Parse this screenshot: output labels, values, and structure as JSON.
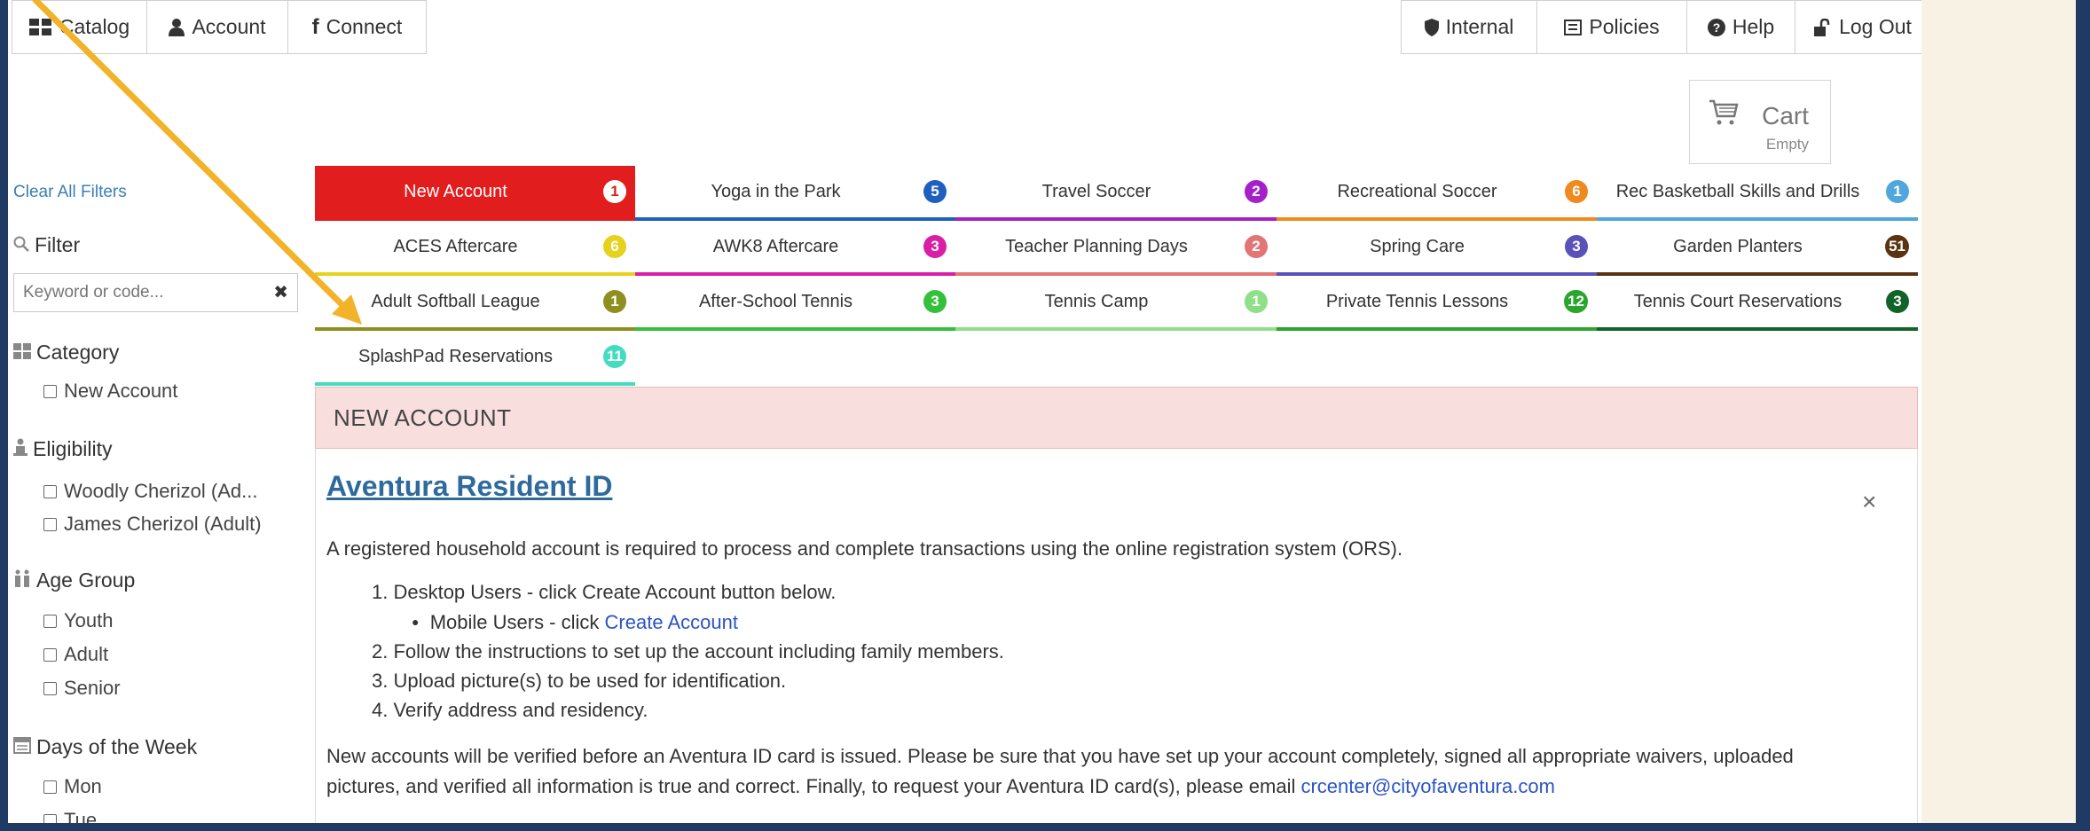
{
  "toolbar": {
    "left": [
      {
        "label": "Catalog",
        "icon": "grid-icon"
      },
      {
        "label": "Account",
        "icon": "user-icon"
      },
      {
        "label": "Connect",
        "icon": "facebook-icon"
      }
    ],
    "right": [
      {
        "label": "Internal",
        "icon": "shield-icon"
      },
      {
        "label": "Policies",
        "icon": "document-icon"
      },
      {
        "label": "Help",
        "icon": "help-icon"
      },
      {
        "label": "Log Out",
        "icon": "unlock-icon"
      }
    ]
  },
  "cart": {
    "label": "Cart",
    "status": "Empty"
  },
  "sidebar": {
    "clear_filters": "Clear All Filters",
    "filter_heading": "Filter",
    "search_placeholder": "Keyword or code...",
    "search_clear": "✖",
    "category": {
      "heading": "Category",
      "items": [
        "New Account"
      ]
    },
    "eligibility": {
      "heading": "Eligibility",
      "items": [
        "Woodly Cherizol (Ad...",
        "James Cherizol (Adult)"
      ]
    },
    "age_group": {
      "heading": "Age Group",
      "items": [
        "Youth",
        "Adult",
        "Senior"
      ]
    },
    "days_of_week": {
      "heading": "Days of the Week",
      "items": [
        "Mon",
        "Tue"
      ]
    }
  },
  "categories": [
    {
      "label": "New Account",
      "count": "1",
      "color": "#e21d1d",
      "active": true
    },
    {
      "label": "Yoga in the Park",
      "count": "5",
      "color": "#1f5fc0"
    },
    {
      "label": "Travel Soccer",
      "count": "2",
      "color": "#a620c9"
    },
    {
      "label": "Recreational Soccer",
      "count": "6",
      "color": "#f08a1c"
    },
    {
      "label": "Rec Basketball Skills and Drills",
      "count": "1",
      "color": "#4fa7de"
    },
    {
      "label": "ACES Aftercare",
      "count": "6",
      "color": "#e6d21d"
    },
    {
      "label": "AWK8 Aftercare",
      "count": "3",
      "color": "#d91fa7"
    },
    {
      "label": "Teacher Planning Days",
      "count": "2",
      "color": "#e27575"
    },
    {
      "label": "Spring Care",
      "count": "3",
      "color": "#5a52b8"
    },
    {
      "label": "Garden Planters",
      "count": "51",
      "color": "#5b3310"
    },
    {
      "label": "Adult Softball League",
      "count": "1",
      "color": "#8f8f1f"
    },
    {
      "label": "After-School Tennis",
      "count": "3",
      "color": "#35c03b"
    },
    {
      "label": "Tennis Camp",
      "count": "1",
      "color": "#8fe088"
    },
    {
      "label": "Private Tennis Lessons",
      "count": "12",
      "color": "#2aa52e"
    },
    {
      "label": "Tennis Court Reservations",
      "count": "3",
      "color": "#12632a"
    },
    {
      "label": "SplashPad Reservations",
      "count": "11",
      "color": "#44dcc0"
    }
  ],
  "section": {
    "heading": "NEW ACCOUNT",
    "item_title": "Aventura Resident ID",
    "close": "×",
    "intro": "A registered household account is required to process and complete transactions using the online registration system (ORS).",
    "steps": [
      "1. Desktop Users - click Create Account button below.",
      "2. Follow the instructions to set up the account including family members.",
      "3. Upload picture(s) to be used for identification.",
      "4. Verify address and residency."
    ],
    "mobile_prefix": "Mobile Users - click ",
    "mobile_link": "Create Account",
    "footer_line1": "New accounts will be verified before an Aventura ID card is issued. Please be sure that you have set up your account completely, signed all appropriate waivers, uploaded",
    "footer_line2_prefix": "pictures, and verified all information is true and correct. Finally, to request your Aventura ID card(s), please email ",
    "footer_email": "crcenter@cityofaventura.com"
  },
  "annotation": {
    "arrow_color": "#f2b22a"
  }
}
